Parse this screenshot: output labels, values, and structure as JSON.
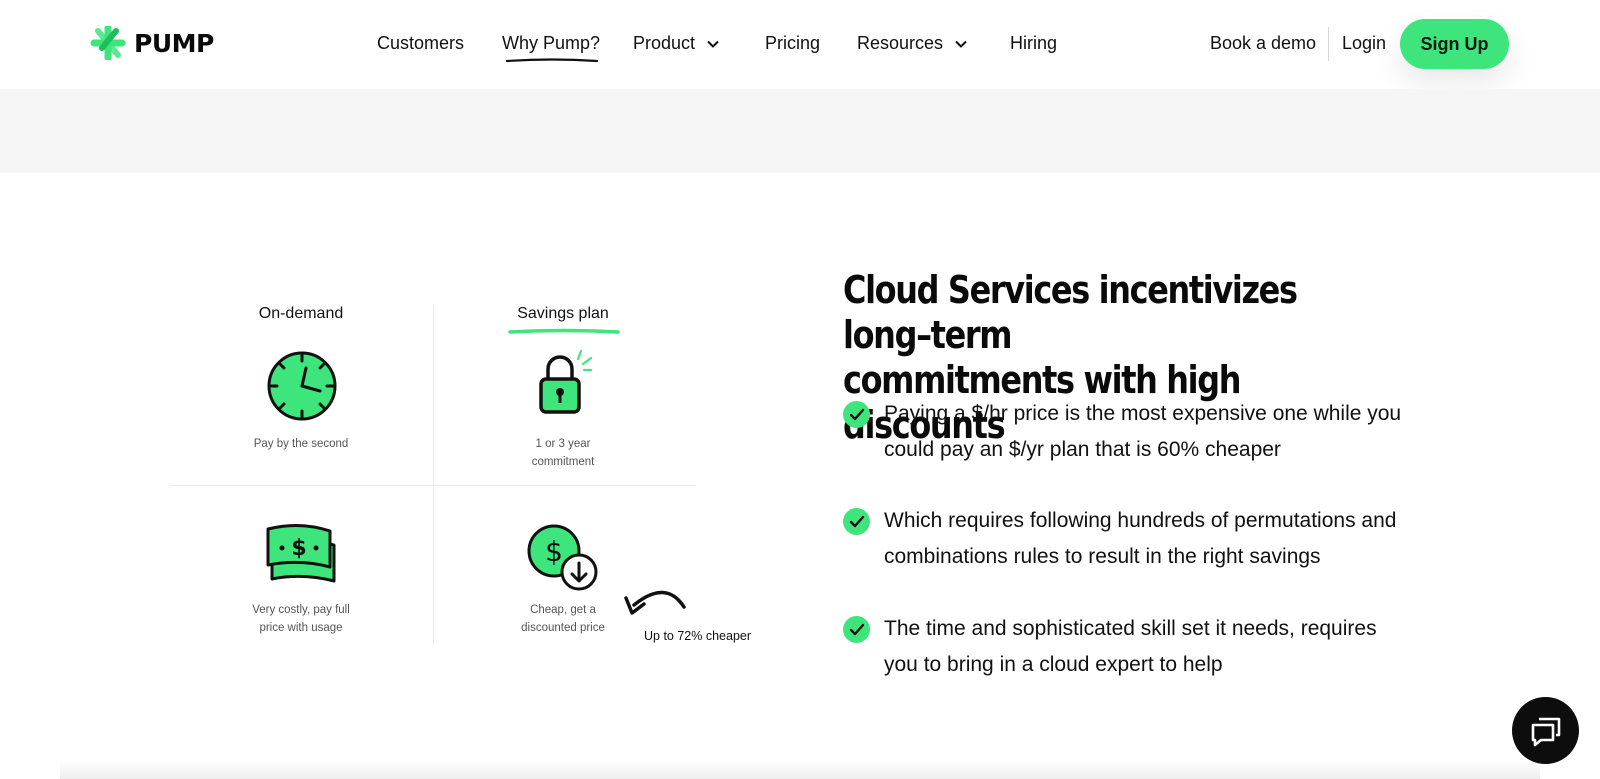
{
  "brand": {
    "name": "PUMP",
    "accent": "#3ee57d"
  },
  "nav": {
    "links": [
      {
        "label": "Customers"
      },
      {
        "label": "Why Pump?"
      },
      {
        "label": "Product"
      },
      {
        "label": "Pricing"
      },
      {
        "label": "Resources"
      },
      {
        "label": "Hiring"
      }
    ],
    "book_demo": "Book a demo",
    "login": "Login",
    "signup": "Sign Up"
  },
  "illustration": {
    "on_demand": {
      "title": "On-demand",
      "caption_top": "Pay by the second",
      "caption_bottom_1": "Very costly, pay full",
      "caption_bottom_2": "price with usage"
    },
    "savings_plan": {
      "title": "Savings plan",
      "caption_top_1": "1 or 3 year",
      "caption_top_2": "commitment",
      "caption_bottom_1": "Cheap, get a",
      "caption_bottom_2": "discounted price"
    },
    "note": "Up to 72% cheaper"
  },
  "content": {
    "heading_line1": "Cloud Services incentivizes long–term",
    "heading_line2": "commitments with high discounts",
    "bullets": [
      {
        "line1": "Paying a $/hr price is the most expensive one while you",
        "line2": "could pay an $/yr plan that is 60% cheaper"
      },
      {
        "line1": "Which requires following hundreds of permutations and",
        "line2": "combinations rules to result in the right savings"
      },
      {
        "line1": "The time and sophisticated skill set it needs, requires",
        "line2": "you to bring in a cloud expert to help"
      }
    ]
  }
}
